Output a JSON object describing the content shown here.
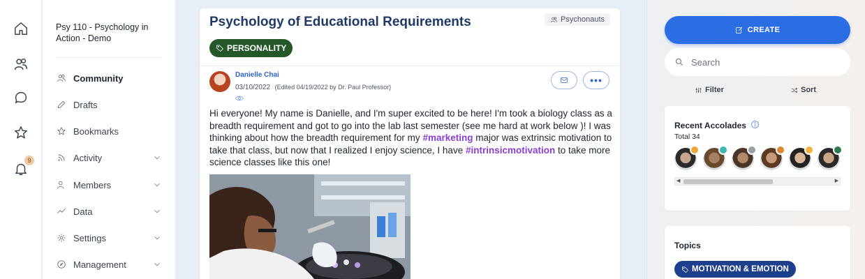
{
  "rail": {
    "notification_count": "9"
  },
  "nav": {
    "course_title": "Psy 110 - Psychology in Action - Demo",
    "items": [
      {
        "label": "Community",
        "icon": "community-icon"
      },
      {
        "label": "Drafts",
        "icon": "pencil-icon"
      },
      {
        "label": "Bookmarks",
        "icon": "star-icon"
      },
      {
        "label": "Activity",
        "icon": "rss-icon"
      },
      {
        "label": "Members",
        "icon": "members-icon"
      },
      {
        "label": "Data",
        "icon": "chart-line-icon"
      },
      {
        "label": "Settings",
        "icon": "gear-icon"
      },
      {
        "label": "Management",
        "icon": "compass-icon"
      }
    ]
  },
  "post": {
    "title": "Psychology of Educational Requirements",
    "community": "Psychonauts",
    "tag": "PERSONALITY",
    "author": "Danielle Chai",
    "date": "03/10/2022",
    "edited": "(Edited 04/19/2022 by Dr. Paul Professor)",
    "body": {
      "part1": "Hi everyone! My name is Danielle, and I'm super excited to be here! I'm took a biology class as a breadth requirement and got to go into the lab last semester (see me hard at work below )! I was thinking about how the breadth requirement for my ",
      "hashtag1": "#marketing",
      "part2": " major was extrinsic motivation to take that class, but now that I realized I enjoy science, I have ",
      "hashtag2": "#intrinsicmotivation",
      "part3": " to take more science classes like this one!"
    }
  },
  "right_panel": {
    "create_label": "CREATE",
    "search_placeholder": "Search",
    "filter_label": "Filter",
    "sort_label": "Sort",
    "accolades": {
      "title": "Recent Accolades",
      "total": "Total 34",
      "avatars": [
        {
          "skin": "#c7a58f",
          "hair": "#2b2b2b",
          "badge": "#f0a63a"
        },
        {
          "skin": "#a77f62",
          "hair": "#6b4a2c",
          "badge": "#3fb6b2"
        },
        {
          "skin": "#b08a6a",
          "hair": "#4a3526",
          "badge": "#9aa0a6"
        },
        {
          "skin": "#c49a7a",
          "hair": "#5e3a22",
          "badge": "#e0892f"
        },
        {
          "skin": "#d9b59a",
          "hair": "#232323",
          "badge": "#f0b43a"
        },
        {
          "skin": "#c9a487",
          "hair": "#2a2a2a",
          "badge": "#2d7a4d"
        }
      ]
    },
    "topics": {
      "title": "Topics",
      "pill": "MOTIVATION & EMOTION"
    }
  },
  "colors": {
    "accent": "#2b6de3",
    "tag_green": "#24582a",
    "hashtag": "#8a3fd1",
    "topic_navy": "#1e3f8c",
    "title_navy": "#1f3a66"
  }
}
